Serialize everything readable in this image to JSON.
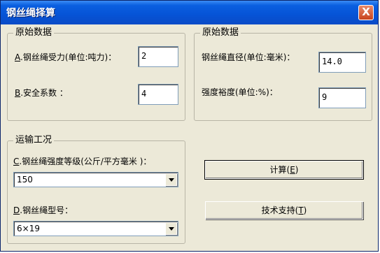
{
  "window": {
    "title": "钢丝绳择算",
    "close_label": "X"
  },
  "group_left": {
    "legend": "原始数据",
    "force": {
      "letter": "A",
      "label": ".钢丝绳受力(单位:吨力)：",
      "value": "2"
    },
    "safety": {
      "letter": "B",
      "label": ".安全系数 ：",
      "value": "4"
    }
  },
  "group_right": {
    "legend": "原始数据",
    "diameter": {
      "label": "钢丝绳直径(单位:毫米)：",
      "value": "14.0"
    },
    "margin": {
      "label": "强度裕度(单位:%)：",
      "value": "9"
    }
  },
  "group_transport": {
    "legend": "运输工况",
    "grade": {
      "letter": "C",
      "label": ".钢丝绳强度等级(公斤/平方毫米 )：",
      "selected": "150"
    },
    "model": {
      "letter": "D",
      "label": ".钢丝绳型号：",
      "selected": "6×19"
    }
  },
  "buttons": {
    "calc": {
      "label": "计算(",
      "key": "E",
      "suffix": ")"
    },
    "support": {
      "label": "技术支持(",
      "key": "T",
      "suffix": ")"
    }
  }
}
